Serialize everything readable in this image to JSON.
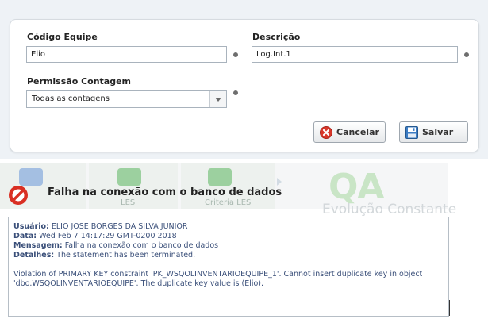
{
  "form": {
    "codigo_label": "Código Equipe",
    "codigo_value": "Elio",
    "descricao_label": "Descrição",
    "descricao_value": "Log.Int.1",
    "permissao_label": "Permissão Contagem",
    "permissao_selected": "Todas as contagens",
    "cancel_label": "Cancelar",
    "save_label": "Salvar"
  },
  "background": {
    "tile2_label": "LES",
    "tile3_label": "Criteria LES",
    "logo_text": "QA",
    "slogan": "Evolução Constante"
  },
  "error": {
    "title": "Falha na conexão com o banco de dados",
    "usuario_key": "Usuário:",
    "usuario_value": "ELIO JOSE BORGES DA SILVA JUNIOR",
    "data_key": "Data:",
    "data_value": "Wed Feb 7 14:17:29 GMT-0200 2018",
    "mensagem_key": "Mensagem:",
    "mensagem_value": "Falha na conexão com o banco de dados",
    "detalhes_key": "Detalhes:",
    "detalhes_value": "The statement has been terminated.",
    "violation_text": "Violation of PRIMARY KEY constraint 'PK_WSQOLINVENTARIOEQUIPE_1'. Cannot insert duplicate key in object 'dbo.WSQOLINVENTARIOEQUIPE'. The duplicate key value is (Elio)."
  },
  "colors": {
    "error_text": "#3a4f79",
    "cancel_icon": "#d9372a",
    "save_icon": "#3b7cc4",
    "tile_blue": "#5b8ed6",
    "tile_green": "#4caf50"
  },
  "icons": {
    "cancel": "close-circle-icon",
    "save": "floppy-disk-icon",
    "error": "no-entry-icon",
    "dropdown": "chevron-down-icon"
  }
}
